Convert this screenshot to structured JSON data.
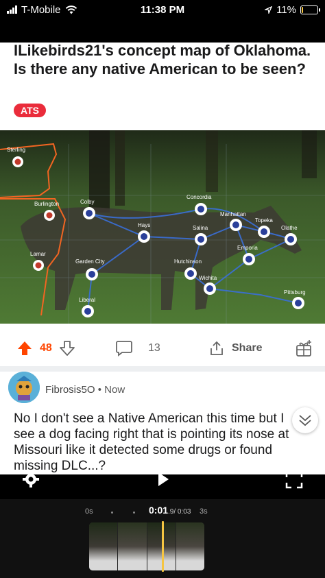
{
  "status_bar": {
    "carrier": "T-Mobile",
    "time": "11:38 PM",
    "battery": "11%",
    "battery_level": 0.11
  },
  "post": {
    "title": "ILikebirds21's concept map of Oklahoma. Is there any native American to be seen?",
    "flair": "ATS",
    "map_labels": {
      "sterling": "Sterling",
      "burlington": "Burlington",
      "colby": "Colby",
      "concordia": "Concordia",
      "manhattan": "Manhattan",
      "topeka": "Topeka",
      "olathe": "Olathe",
      "hays": "Hays",
      "salina": "Salina",
      "lamar": "Lamar",
      "garden_city": "Garden City",
      "emporia": "Emporia",
      "hutchinson": "Hutchinson",
      "wichita": "Wichita",
      "pittsburg": "Pittsburg",
      "liberal": "Liberal"
    },
    "actions": {
      "upvotes": "48",
      "comments": "13",
      "share": "Share"
    }
  },
  "comment": {
    "author": "Fibrosis5O",
    "separator": "•",
    "time": "Now",
    "text": "No I don't see a Native American this time but I see a dog facing right that is pointing its nose at Missouri like it detected some drugs or found missing DLC...?"
  },
  "video": {
    "start_label": "0s",
    "current": "0:01",
    "current_fraction": ".9",
    "total": "/ 0:03",
    "end_label": "3s",
    "progress": 0.63
  },
  "colors": {
    "upvote": "#ff4500",
    "flair": "#ea2c3b",
    "playhead": "#f5c542",
    "colorado_border": "#f26522",
    "route": "#3a6fd8"
  },
  "icons": [
    "wifi-icon",
    "location-arrow-icon",
    "upvote-arrow-icon",
    "downvote-arrow-icon",
    "comment-bubble-icon",
    "share-icon",
    "award-icon",
    "chevron-down-icon",
    "settings-gear-icon",
    "play-icon",
    "fullscreen-icon"
  ]
}
